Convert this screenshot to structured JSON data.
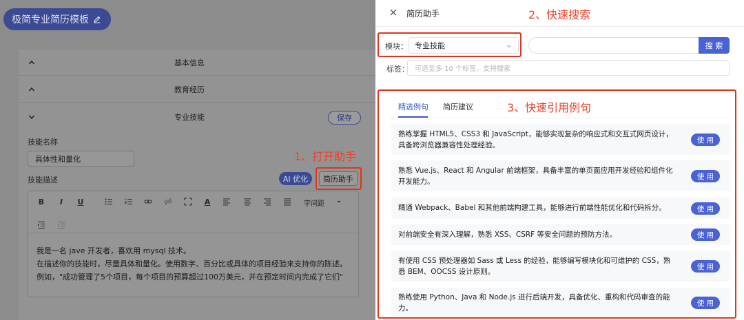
{
  "left_panel": {
    "title": "极简专业简历模板",
    "sections": [
      {
        "label": "基本信息",
        "expanded": false
      },
      {
        "label": "教育经历",
        "expanded": false
      },
      {
        "label": "专业技能",
        "expanded": true
      }
    ],
    "save_label": "保存",
    "skill_name_label": "技能名称",
    "skill_name_value": "具体性和量化",
    "skill_desc_label": "技能描述",
    "ai_optimize_label": "AI 优化",
    "resume_helper_label": "简历助手",
    "toolbar": {
      "spacing_label": "字间距"
    },
    "editor_lines": [
      "我是一名 jave 开发者，喜欢用 mysql 技术。",
      "在描述你的技能时，尽量具体和量化。使用数字、百分比或具体的项目经验来支持你的陈述。",
      "例如，\"成功管理了5个项目，每个项目的预算超过100万美元，并在预定时间内完成了它们\""
    ]
  },
  "annotations": {
    "step1": "1、打开助手",
    "step2": "2、快速搜索",
    "step3": "3、快速引用例句"
  },
  "drawer": {
    "title": "简历助手",
    "module_label": "模块：",
    "module_value": "专业技能",
    "search_value": "",
    "search_button": "搜 索",
    "tags_label": "标签：",
    "tags_placeholder": "可选至多 10 个标签，支持搜索",
    "tabs": [
      {
        "label": "精选例句",
        "active": true
      },
      {
        "label": "简历建议",
        "active": false
      }
    ],
    "use_label": "使 用",
    "sentences": [
      {
        "lines": [
          "熟练掌握 HTML5、CSS3 和 JavaScript，能够实现复杂的响应式和交互式网页设计，",
          "具备跨浏览器兼容性处理经验。"
        ]
      },
      {
        "lines": [
          "熟悉 Vue.js、React 和 Angular 前端框架，具备丰富的单页面应用开发经验和组件化",
          "开发能力。"
        ]
      },
      {
        "lines": [
          "精通 Webpack、Babel 和其他前端构建工具，能够进行前端性能优化和代码拆分。"
        ]
      },
      {
        "lines": [
          "对前端安全有深入理解，熟悉 XSS、CSRF 等安全问题的预防方法。"
        ]
      },
      {
        "lines": [
          "有使用 CSS 预处理器如 Sass 或 Less 的经验，能够编写模块化和可维护的 CSS，熟",
          "悉 BEM、OOCSS 设计原则。"
        ]
      },
      {
        "lines": [
          "熟练使用 Python、Java 和 Node.js 进行后端开发，具备优化、重构和代码审查的能",
          "力。"
        ]
      }
    ]
  }
}
